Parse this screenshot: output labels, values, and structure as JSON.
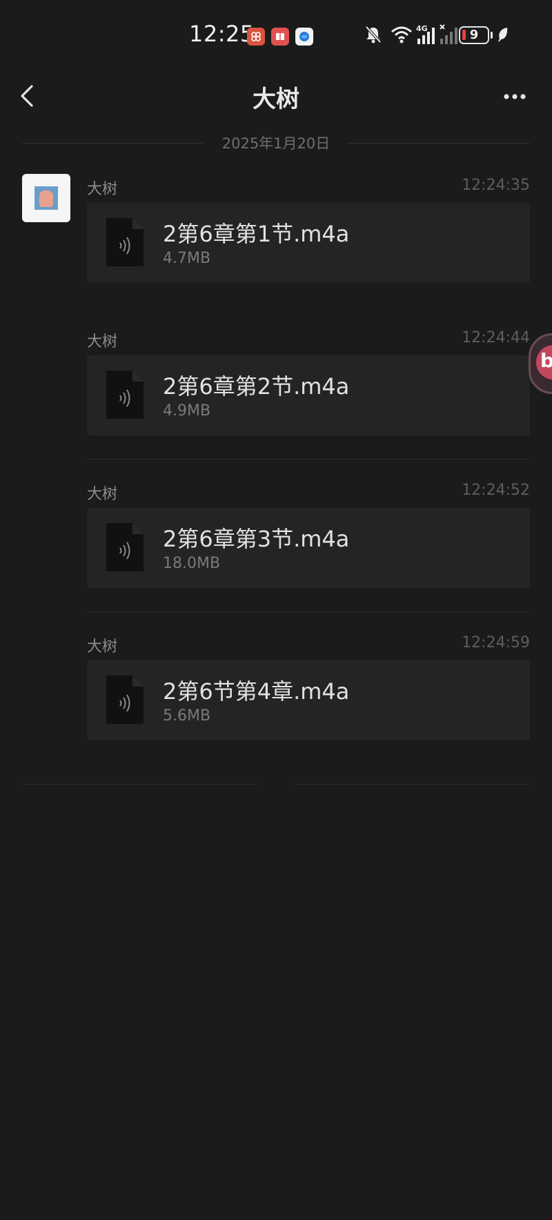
{
  "status_bar": {
    "time": "12:25",
    "network_label": "4G",
    "battery_level": "9",
    "colors": {
      "battery_low": "#e84040"
    },
    "icons": [
      "app-red-grid-icon",
      "app-red-book-icon",
      "app-blue-globe-icon",
      "muted-bell-icon",
      "wifi-icon",
      "signal-4g-icon",
      "signal-no-service-icon",
      "battery-icon",
      "leaf-icon"
    ]
  },
  "header": {
    "title": "大树",
    "back_icon": "chevron-left-icon",
    "more_icon": "more-dots-icon"
  },
  "chat": {
    "date_label": "2025年1月20日",
    "messages": [
      {
        "sender": "大树",
        "time": "12:24:35",
        "file_name": "2第6章第1节.m4a",
        "file_size": "4.7MB"
      },
      {
        "sender": "大树",
        "time": "12:24:44",
        "file_name": "2第6章第2节.m4a",
        "file_size": "4.9MB"
      },
      {
        "sender": "大树",
        "time": "12:24:52",
        "file_name": "2第6章第3节.m4a",
        "file_size": "18.0MB"
      },
      {
        "sender": "大树",
        "time": "12:24:59",
        "file_name": "2第6节第4章.m4a",
        "file_size": "5.6MB"
      }
    ]
  },
  "floating_bubble": {
    "label": "bi"
  },
  "theme": {
    "background": "#1b1b1b",
    "card": "#242424",
    "text": "#e2e2e2",
    "muted": "#7a7a7a"
  }
}
